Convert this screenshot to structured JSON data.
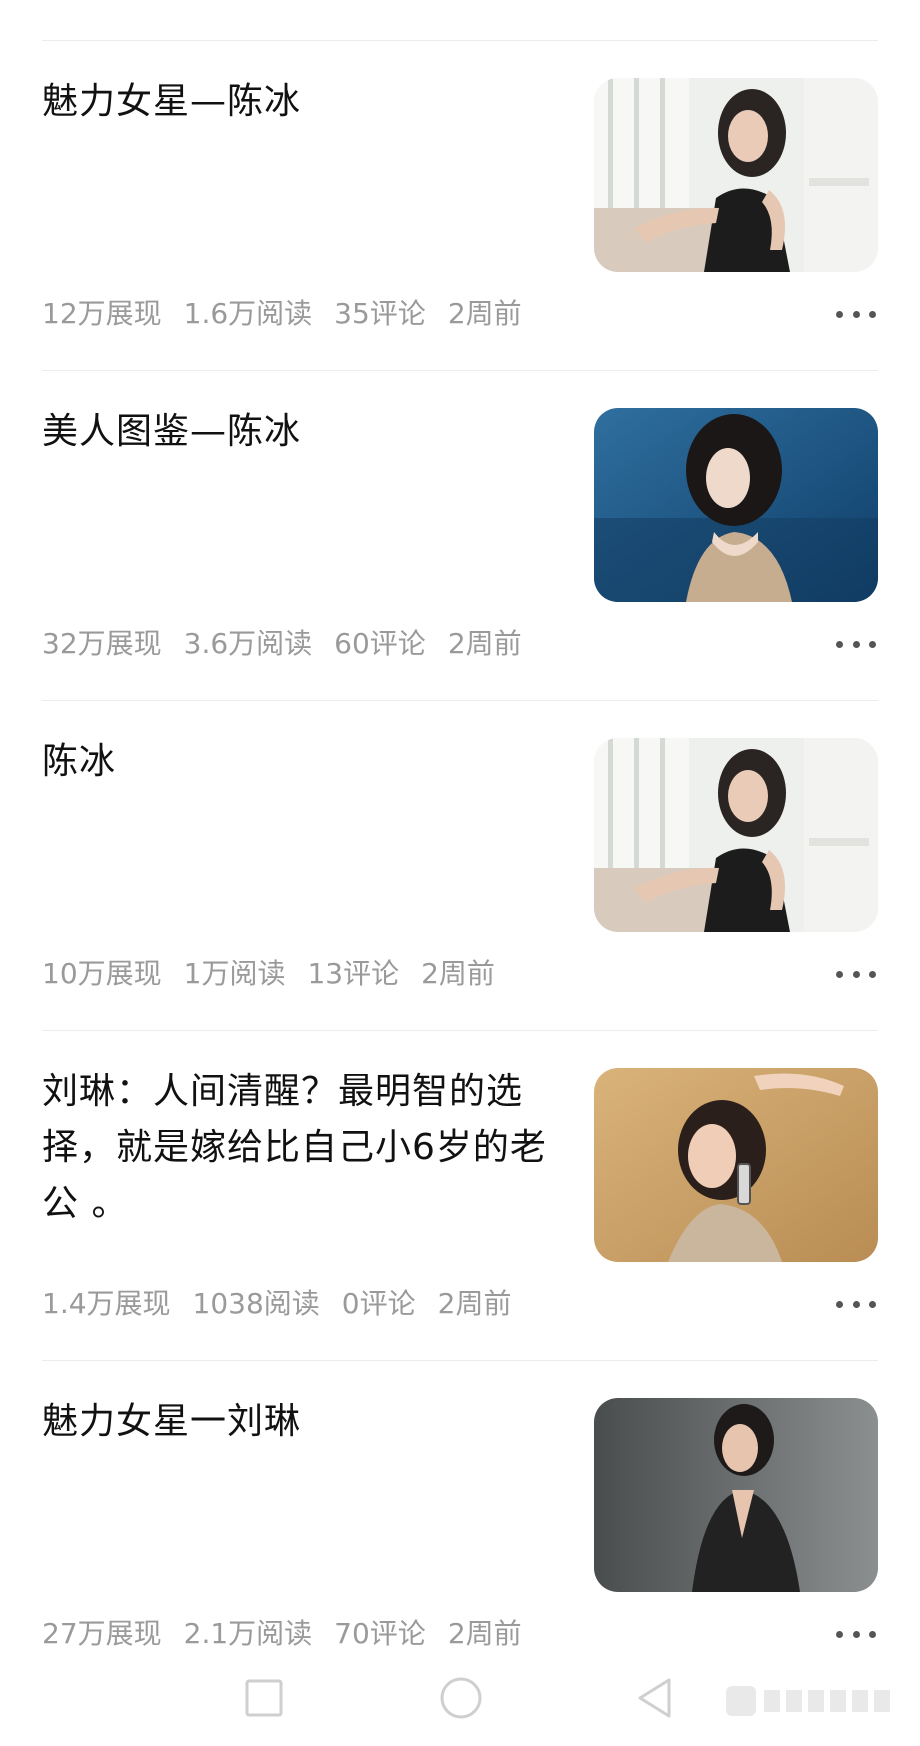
{
  "articles": [
    {
      "title": "魅力女星—陈冰",
      "stats": {
        "views": "12万展现",
        "reads": "1.6万阅读",
        "comments": "35评论",
        "time": "2周前"
      },
      "thumbnail": {
        "scene": "bright-room",
        "accent": "#1c1c1c"
      }
    },
    {
      "title": "美人图鉴—陈冰",
      "stats": {
        "views": "32万展现",
        "reads": "3.6万阅读",
        "comments": "60评论",
        "time": "2周前"
      },
      "thumbnail": {
        "scene": "blue-backdrop",
        "accent": "#c7ad8f"
      }
    },
    {
      "title": "陈冰",
      "stats": {
        "views": "10万展现",
        "reads": "1万阅读",
        "comments": "13评论",
        "time": "2周前"
      },
      "thumbnail": {
        "scene": "bright-room",
        "accent": "#1c1c1c"
      }
    },
    {
      "title": "刘琳：人间清醒？最明智的选择，就是嫁给比自己小6岁的老公 。",
      "stats": {
        "views": "1.4万展现",
        "reads": "1038阅读",
        "comments": "0评论",
        "time": "2周前"
      },
      "thumbnail": {
        "scene": "golden-backdrop",
        "accent": "#c9b69c"
      }
    },
    {
      "title": "魅力女星一刘琳",
      "stats": {
        "views": "27万展现",
        "reads": "2.1万阅读",
        "comments": "70评论",
        "time": "2周前"
      },
      "thumbnail": {
        "scene": "gray-backdrop",
        "accent": "#222222"
      }
    }
  ],
  "icons": {
    "more": "more-horizontal-icon",
    "nav_recent": "square-icon",
    "nav_home": "circle-icon",
    "nav_back": "triangle-back-icon"
  },
  "colors": {
    "title": "#111111",
    "stats": "#9a9a9a",
    "divider": "#ececec",
    "nav_icon": "#cfcfcf"
  }
}
